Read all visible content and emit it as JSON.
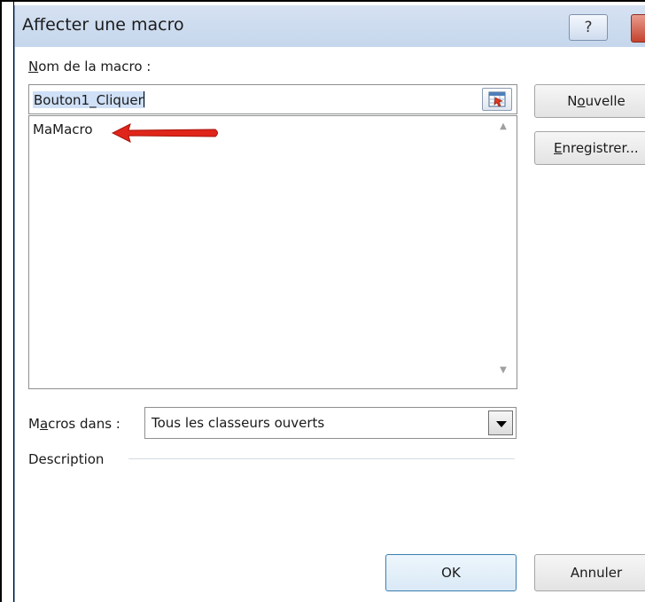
{
  "dialog": {
    "title": "Affecter une macro",
    "help_label": "?"
  },
  "form": {
    "name_label_underlined": "N",
    "name_label_rest": "om de la macro :",
    "name_value": "Bouton1_Cliquer",
    "list_items": [
      "MaMacro"
    ],
    "macros_in_label_pre": "M",
    "macros_in_label_underlined": "a",
    "macros_in_label_post": "cros dans :",
    "macros_in_value": "Tous les classeurs ouverts",
    "description_label": "Description"
  },
  "buttons": {
    "new_pre": "N",
    "new_underlined": "o",
    "new_post": "uvelle",
    "record_underlined": "E",
    "record_rest": "nregistrer...",
    "ok": "OK",
    "cancel": "Annuler"
  },
  "colors": {
    "annotation_arrow": "#e0251b",
    "titlebar": "#c9d8ee"
  }
}
